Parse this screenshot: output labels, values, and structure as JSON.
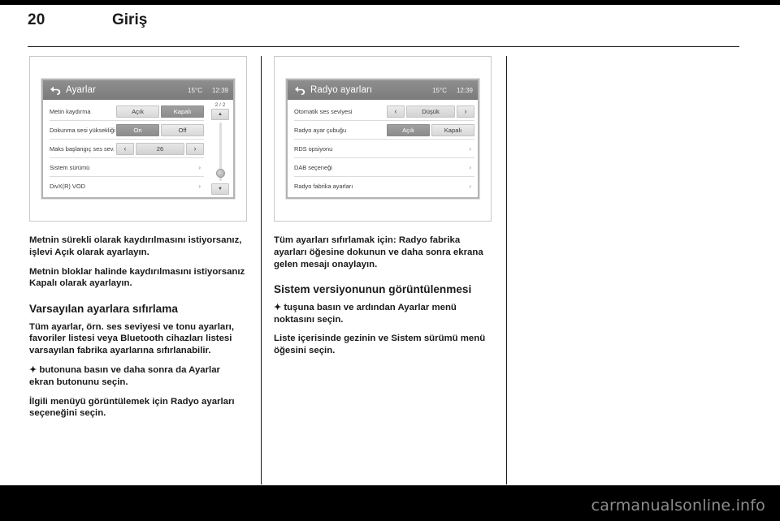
{
  "header": {
    "page_number": "20",
    "chapter_title": "Giriş"
  },
  "left_column": {
    "figure": {
      "back_icon": "back-arrow-icon",
      "title": "Ayarlar",
      "temperature": "15°C",
      "clock": "12:39",
      "page_indicator": "2 / 2",
      "scroll_up_glyph": "▲",
      "scroll_down_glyph": "▼",
      "rows": [
        {
          "label": "Metin kaydırma",
          "type": "segmented",
          "options": [
            "Açık",
            "Kapalı"
          ],
          "selected": "Kapalı"
        },
        {
          "label": "Dokunma sesi yüksekliği",
          "type": "segmented",
          "options": [
            "On",
            "Off"
          ],
          "selected": "On"
        },
        {
          "label": "Maks başlangıç ses sev.",
          "type": "stepper",
          "prev_glyph": "‹",
          "next_glyph": "›",
          "value": "26"
        },
        {
          "label": "Sistem sürümü",
          "type": "submenu",
          "chevron": "›"
        },
        {
          "label": "DivX(R) VOD",
          "type": "submenu",
          "chevron": "›"
        }
      ]
    },
    "paragraphs": [
      "Metnin sürekli olarak kaydırılmasını istiyorsanız, işlevi Açık olarak ayarlayın.",
      "Metnin bloklar halinde kaydırılmasını istiyorsanız Kapalı olarak ayarlayın."
    ],
    "subheading": "Varsayılan ayarlara sıfırlama",
    "paragraphs2": [
      "Tüm ayarlar, örn. ses seviyesi ve tonu ayarları, favoriler listesi veya Bluetooth cihazları listesi varsayılan fabrika ayarlarına sıfırlanabilir.",
      "butonuna basın ve daha sonra da Ayarlar ekran butonunu seçin.",
      "İlgili menüyü görüntülemek için Radyo ayarları seçeneğini seçin."
    ],
    "gear_glyph": "✦"
  },
  "right_column": {
    "figure": {
      "back_icon": "back-arrow-icon",
      "title": "Radyo ayarları",
      "temperature": "15°C",
      "clock": "12:39",
      "rows": [
        {
          "label": "Otomatik ses seviyesi",
          "type": "stepper",
          "prev_glyph": "‹",
          "next_glyph": "›",
          "value": "Düşük"
        },
        {
          "label": "Radyo ayar çubuğu",
          "type": "segmented",
          "options": [
            "Açık",
            "Kapalı"
          ],
          "selected": "Açık"
        },
        {
          "label": "RDS opsiyonu",
          "type": "submenu",
          "chevron": "›"
        },
        {
          "label": "DAB seçeneği",
          "type": "submenu",
          "chevron": "›"
        },
        {
          "label": "Radyo fabrika ayarları",
          "type": "submenu",
          "chevron": "›"
        }
      ]
    },
    "paragraphs": [
      "Tüm ayarları sıfırlamak için: Radyo fabrika ayarları öğesine dokunun ve daha sonra ekrana gelen mesajı onaylayın."
    ],
    "subheading": "Sistem versiyonunun görüntülenmesi",
    "paragraphs2": [
      "tuşuna basın ve ardından Ayarlar menü noktasını seçin.",
      "Liste içerisinde gezinin ve Sistem sürümü menü öğesini seçin."
    ],
    "gear_glyph": "✦"
  },
  "footer": {
    "watermark": "carmanualsonline.info"
  },
  "colors": {
    "titlebar": "#7b7b7b",
    "active_segment": "#8c8c8c",
    "page_text": "#1a1a1a",
    "footer_bg": "#000000",
    "watermark_text": "#8d8d8d"
  }
}
